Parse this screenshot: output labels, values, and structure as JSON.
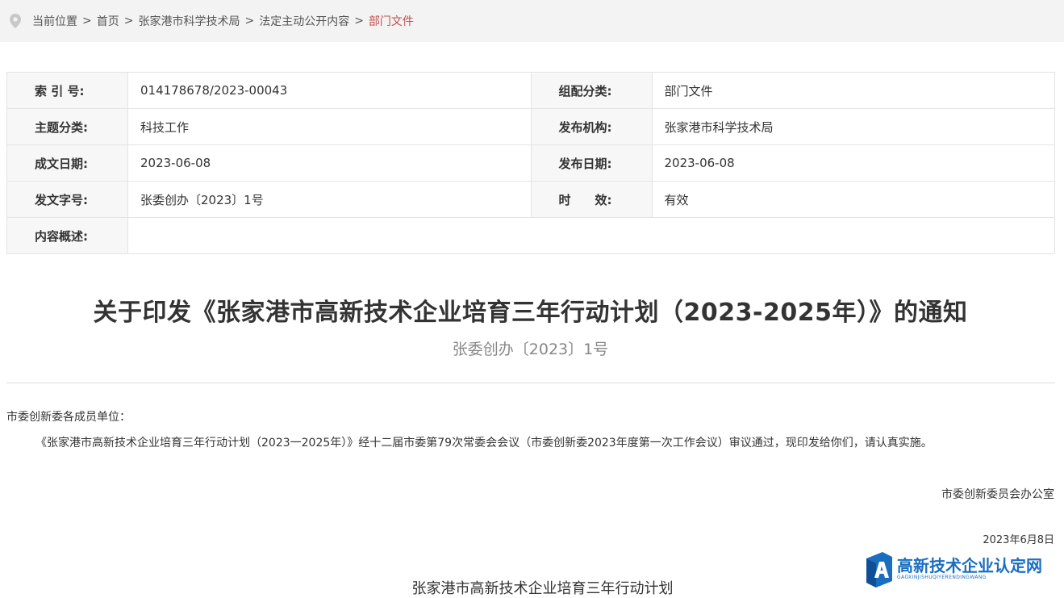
{
  "breadcrumb": {
    "label": "当前位置",
    "items": [
      "首页",
      "张家港市科学技术局",
      "法定主动公开内容"
    ],
    "current": "部门文件",
    "separator": ">"
  },
  "meta": {
    "index_label": "索 引 号:",
    "index_value": "014178678/2023-00043",
    "category_label": "组配分类:",
    "category_value": "部门文件",
    "topic_label": "主题分类:",
    "topic_value": "科技工作",
    "publisher_label": "发布机构:",
    "publisher_value": "张家港市科学技术局",
    "written_label": "成文日期:",
    "written_value": "2023-06-08",
    "published_label": "发布日期:",
    "published_value": "2023-06-08",
    "docno_label": "发文字号:",
    "docno_value": "张委创办〔2023〕1号",
    "validity_label": "时　　效:",
    "validity_value": "有效",
    "summary_label": "内容概述:",
    "summary_value": ""
  },
  "document": {
    "title": "关于印发《张家港市高新技术企业培育三年行动计划（2023-2025年）》的通知",
    "subtitle": "张委创办〔2023〕1号",
    "addressee": "市委创新委各成员单位：",
    "paragraph": "《张家港市高新技术企业培育三年行动计划（2023一2025年）》经十二届市委第79次常委会会议（市委创新委2023年度第一次工作会议）审议通过，现印发给你们，请认真实施。",
    "signer": "市委创新委员会办公室",
    "date": "2023年6月8日",
    "attachment_title": "张家港市高新技术企业培育三年行动计划"
  },
  "watermark": {
    "text": "高新技术企业认定网",
    "subtext": "GAOXINJISHUQIYERENDINGWANG",
    "color": "#1a6ec0"
  },
  "colors": {
    "current_crumb": "#c0504d",
    "label_bg": "#f7f7f7",
    "breadcrumb_bg": "#f3f3f3"
  }
}
